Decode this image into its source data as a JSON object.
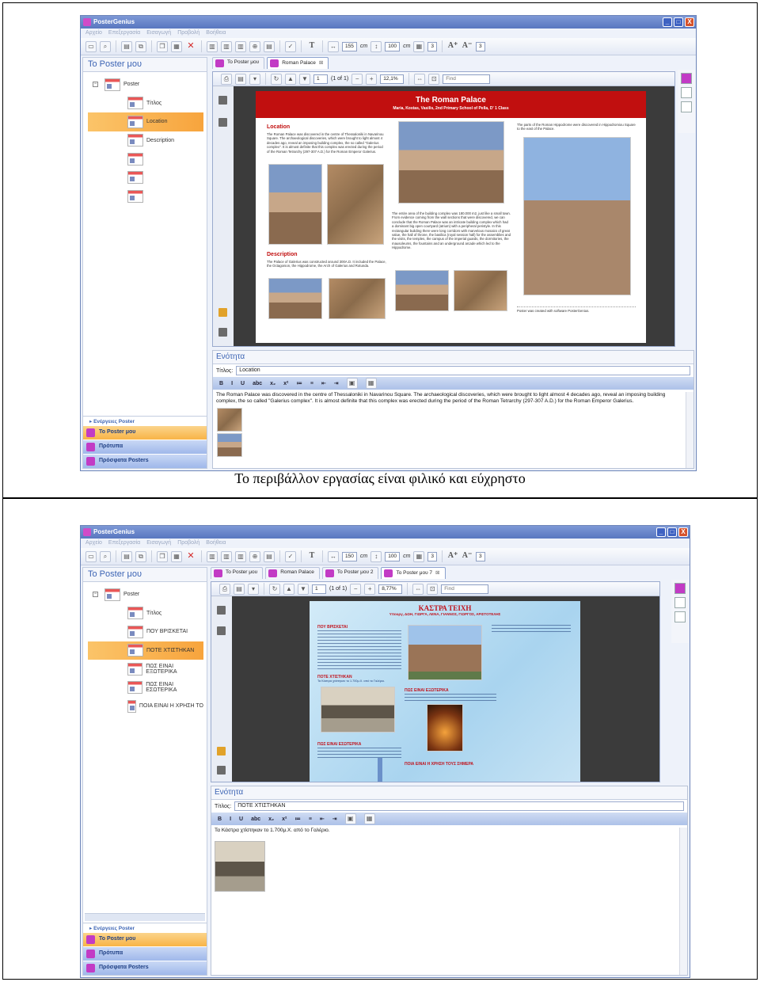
{
  "caption": "Το περιβάλλον εργασίας είναι φιλικό και εύχρηστο",
  "app": {
    "title": "PosterGenius",
    "menu": [
      "Αρχείο",
      "Επεξεργασία",
      "Εισαγωγή",
      "Προβολή",
      "Βοήθεια"
    ],
    "win_buttons": [
      "_",
      "□",
      "X"
    ]
  },
  "panel": {
    "title": "Το Poster μου",
    "actions": "Ενέργειες Poster",
    "nav": [
      "Το Poster μου",
      "Πρότυπα",
      "Πρόσφατα Posters"
    ]
  },
  "section": {
    "title": "Ενότητα",
    "title_label": "Τίτλος:",
    "rt_buttons": [
      "B",
      "I",
      "U",
      "abc",
      "x₂",
      "x²",
      "≔",
      "≡",
      "⇤",
      "⇥"
    ]
  },
  "screen1": {
    "toolbar": {
      "width": "155",
      "width_unit": "cm",
      "height": "100",
      "height_unit": "cm",
      "cols": "3",
      "font_step": "3"
    },
    "tabs": [
      {
        "label": "Το Poster μου",
        "close": ""
      },
      {
        "label": "Roman Palace",
        "close": "⊠"
      }
    ],
    "viewer": {
      "page": "1",
      "page_of": "(1 of 1)",
      "zoom": "12,1%",
      "find_placeholder": "Find"
    },
    "tree": [
      "Poster",
      "Τίτλος",
      "Location",
      "Description",
      "",
      "",
      ""
    ],
    "section_title_value": "Location",
    "section_text": "The Roman Palace was discovered in the centre of Thessaloniki in Navarinou Square. The archaeological discoveries, which were brought to light almost 4 decades ago, reveal an imposing building complex, the so called \"Galerius complex\". It is almost definite that this complex was erected during the period of the Roman Tetrarchy (297-307 A.D.) for the Roman Emperor Galerius.",
    "poster": {
      "title": "The Roman Palace",
      "subtitle": "Maria, Kostas, Vasilis",
      "subtitle2": "2nd Primary School of Pella, D' 1 Class",
      "loc_head": "Location",
      "loc_text": "The Roman Palace was discovered in the centre of Thessaloniki in Navarinou Square. The archaeological discoveries, which were brought to light almost 4 decades ago, reveal an imposing building complex, the so called \"Galerius complex\". It is almost definite that this complex was erected during the period of the Roman Tetrarchy (297-307 A.D.) for the Roman Emperor Galerius.",
      "desc_head": "Description",
      "desc_text": "The Palace of Galerius was constructed around 300A.D. It included the Palace, the Octagonion, the Hippodrome, the Arch of Galerius and Rotunda.",
      "mid_text": "The entire area of the building complex was 180.000 m2, just like a small town. From evidence coming from the wall sections that were discovered, we can conclude that the Roman Palace was an intricate building complex which had a dominant big open courtyard (atrium) with a peripheral peristyle. In this rectangular building there were long corridors with marvelous mosaics of great value, the hall of throne, the basilica (royal session hall) for the assemblies and the visits, the temples, the campus of the imperial guards, the dormitories, the mausoleums, the fountains and an underground arcade which led to the Hippodrome.",
      "right_text": "The parts of the Roman Hippodrome were discovered in Hippodromiou Square to the east of the Palace.",
      "footer": "Poster was created with software PosterGenius."
    }
  },
  "screen2": {
    "toolbar": {
      "width": "150",
      "width_unit": "cm",
      "height": "100",
      "height_unit": "cm",
      "cols": "3",
      "font_step": "3"
    },
    "tabs": [
      {
        "label": "Το Poster μου",
        "close": ""
      },
      {
        "label": "Roman Palace",
        "close": ""
      },
      {
        "label": "Το Poster μου 2",
        "close": ""
      },
      {
        "label": "Το Poster μου 7",
        "close": "⊠"
      }
    ],
    "viewer": {
      "page": "1",
      "page_of": "(1 of 1)",
      "zoom": "8,77%",
      "find_placeholder": "Find"
    },
    "tree": [
      "Poster",
      "Τίτλος",
      "ΠΟΥ ΒΡΙΣΚΕΤΑΙ",
      "ΠΟΤΕ ΧΤΙΣΤΗΚΑΝ",
      "ΠΩΣ ΕΙΝΑΙ ΕΞΩΤΕΡΙΚΑ",
      "ΠΩΣ ΕΙΝΑΙ ΕΣΩΤΕΡΙΚΑ",
      "ΠΟΙΑ ΕΙΝΑΙ Η ΧΡΗΣΗ ΤΟ"
    ],
    "section_title_value": "ΠΟΤΕ ΧΤΙΣΤΗΚΑΝ",
    "section_text": "Τα Κάστρα χτίστηκαν το 1.700μ.Χ. από το Γαλέριο.",
    "poster": {
      "title": "ΚΑΣΤΡΑ ΤΕΙΧΗ",
      "subtitle": "Υπουργ, ΔΩΗ, ΓΙΩΡΓΑ, ΛΕΝΑ, ΓΙΑΝΝΟΣ, ΓΙΩΡΓΟΣ, ΑΡΙΣΤΟΤΕΛΗΣ",
      "h1": "ΠΟΥ ΒΡΙΣΚΕΤΑΙ",
      "h2": "ΠΟΤΕ ΧΤΙΣΤΗΚΑΝ",
      "h3": "ΠΩΣ ΕΙΝΑΙ ΕΞΩΤΕΡΙΚΑ",
      "h4": "ΠΩΣ ΕΙΝΑΙ ΕΣΩΤΕΡΙΚΑ",
      "h5": "ΠΟΙΑ ΕΙΝΑΙ Η ΧΡΗΣΗ ΤΟΥΣ ΣΗΜΕΡΑ",
      "t2": "Τα Κάστρα χτίστηκαν το 1.700μ.Χ. από το Γαλέριο."
    }
  }
}
